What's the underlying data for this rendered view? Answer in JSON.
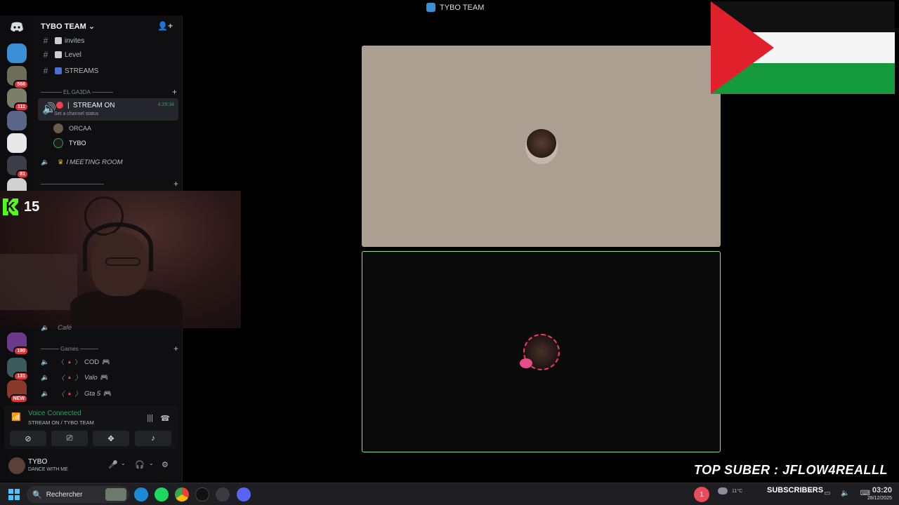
{
  "window": {
    "title": "TYBO TEAM"
  },
  "server": {
    "name": "TYBO TEAM ⌄"
  },
  "rail": {
    "badges": [
      "566",
      "111",
      "81",
      "190",
      "131",
      "NEW"
    ]
  },
  "channels": {
    "text": [
      {
        "label": "invites"
      },
      {
        "label": "Level"
      },
      {
        "label": "STREAMS"
      }
    ],
    "category_elgasda": "EL GA3DA",
    "stream_on": {
      "name": "STREAM ON",
      "status": "Set a channel status",
      "time": "4:29:34"
    },
    "users": [
      "ORCAA",
      "TYBO"
    ],
    "meeting_room": "MEETING ROOM",
    "partial_channel": "Café",
    "category_games": "Games",
    "games": [
      "COD",
      "Valo",
      "Gta 5"
    ]
  },
  "kick": {
    "count": "15"
  },
  "voice": {
    "status": "Voice Connected",
    "location": "STREAM ON / TYBO TEAM"
  },
  "user": {
    "name": "TYBO",
    "status": "DANCE WITH ME"
  },
  "overlay": {
    "top_suber": "TOP SUBER : JFLOW4REALLL"
  },
  "taskbar": {
    "search_placeholder": "Rechercher",
    "notification_count": "1",
    "temperature": "11°C",
    "subscribers": "SUBSCRIBERS",
    "time": "03:20",
    "date": "28/12/2025"
  },
  "colors": {
    "accent_green": "#23a55a",
    "speaking_border": "#8fe08a",
    "flag_red": "#e0202a",
    "flag_green": "#149a3c"
  }
}
